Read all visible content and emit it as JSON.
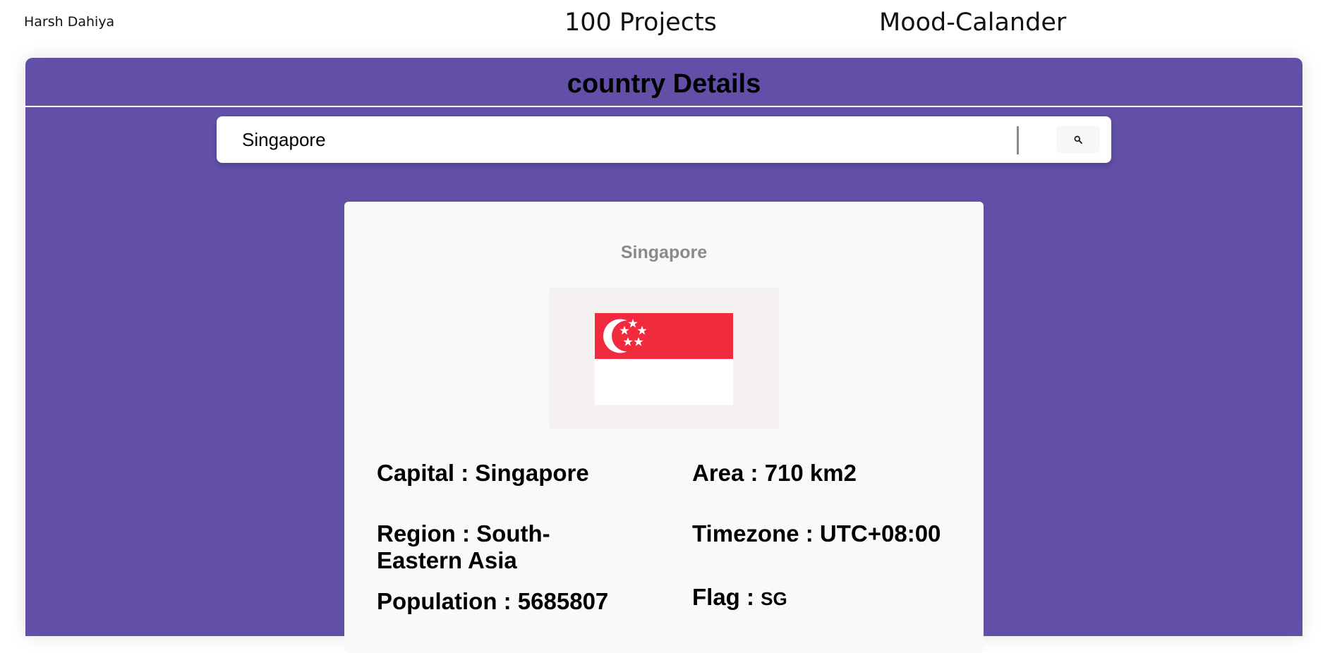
{
  "header": {
    "author": "Harsh Dahiya",
    "nav": [
      {
        "label": "100 Projects"
      },
      {
        "label": "Mood-Calander"
      }
    ]
  },
  "panel": {
    "title": "country Details"
  },
  "search": {
    "value": "Singapore",
    "button_icon": "search-icon"
  },
  "country": {
    "name": "Singapore",
    "flag_icon": "singapore-flag",
    "capital": "Capital : Singapore",
    "area": "Area : 710 km2",
    "region": "Region : South-Eastern Asia",
    "timezone": "Timezone : UTC+08:00",
    "population": "Population : 5685807",
    "flag_label": "Flag : ",
    "flag_code": "SG"
  },
  "colors": {
    "panel_bg": "#6250a8",
    "flag_red": "#ef2b3d",
    "flag_white": "#ffffff"
  }
}
